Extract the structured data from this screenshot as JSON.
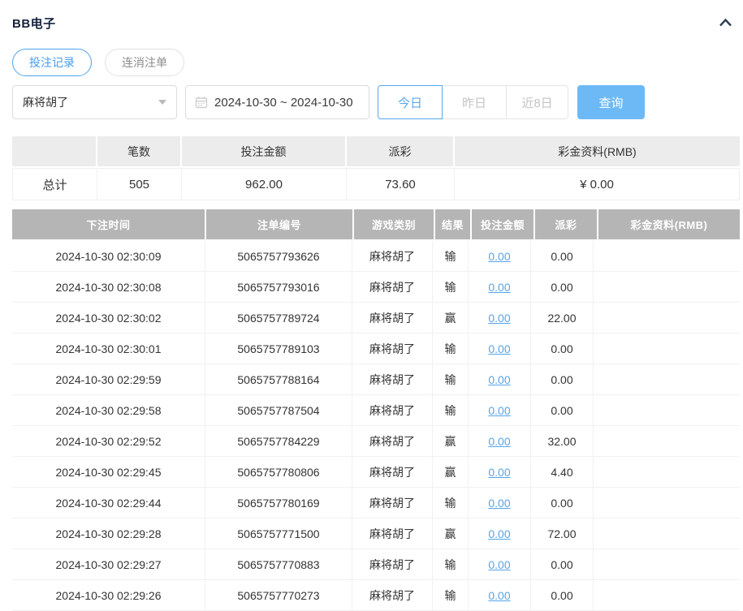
{
  "page": {
    "title": "BB电子"
  },
  "tabs": [
    {
      "label": "投注记录",
      "active": true
    },
    {
      "label": "连消注单",
      "active": false
    }
  ],
  "filters": {
    "game_select": {
      "value": "麻将胡了"
    },
    "date_range": {
      "value": "2024-10-30 ~ 2024-10-30"
    },
    "quick_ranges": [
      {
        "label": "今日",
        "active": true
      },
      {
        "label": "昨日",
        "active": false
      },
      {
        "label": "近8日",
        "active": false
      }
    ],
    "search_label": "查询"
  },
  "summary_table": {
    "headers": [
      "",
      "笔数",
      "投注金额",
      "派彩",
      "彩金资料(RMB)"
    ],
    "totals_row": [
      "总计",
      "505",
      "962.00",
      "73.60",
      "¥ 0.00"
    ]
  },
  "detail_table": {
    "headers": [
      "下注时间",
      "注单编号",
      "游戏类别",
      "结果",
      "投注金额",
      "派彩",
      "彩金资料(RMB)"
    ],
    "rows": [
      [
        "2024-10-30 02:30:09",
        "5065757793626",
        "麻将胡了",
        "输",
        "0.00",
        "0.00",
        ""
      ],
      [
        "2024-10-30 02:30:08",
        "5065757793016",
        "麻将胡了",
        "输",
        "0.00",
        "0.00",
        ""
      ],
      [
        "2024-10-30 02:30:02",
        "5065757789724",
        "麻将胡了",
        "赢",
        "0.00",
        "22.00",
        ""
      ],
      [
        "2024-10-30 02:30:01",
        "5065757789103",
        "麻将胡了",
        "输",
        "0.00",
        "0.00",
        ""
      ],
      [
        "2024-10-30 02:29:59",
        "5065757788164",
        "麻将胡了",
        "输",
        "0.00",
        "0.00",
        ""
      ],
      [
        "2024-10-30 02:29:58",
        "5065757787504",
        "麻将胡了",
        "输",
        "0.00",
        "0.00",
        ""
      ],
      [
        "2024-10-30 02:29:52",
        "5065757784229",
        "麻将胡了",
        "赢",
        "0.00",
        "32.00",
        ""
      ],
      [
        "2024-10-30 02:29:45",
        "5065757780806",
        "麻将胡了",
        "赢",
        "0.00",
        "4.40",
        ""
      ],
      [
        "2024-10-30 02:29:44",
        "5065757780169",
        "麻将胡了",
        "输",
        "0.00",
        "0.00",
        ""
      ],
      [
        "2024-10-30 02:29:28",
        "5065757771500",
        "麻将胡了",
        "赢",
        "0.00",
        "72.00",
        ""
      ],
      [
        "2024-10-30 02:29:27",
        "5065757770883",
        "麻将胡了",
        "输",
        "0.00",
        "0.00",
        ""
      ],
      [
        "2024-10-30 02:29:26",
        "5065757770273",
        "麻将胡了",
        "输",
        "0.00",
        "0.00",
        ""
      ]
    ]
  },
  "colors": {
    "accent_blue": "#4da3ee",
    "link_blue": "#56a4e8",
    "search_button_bg": "#6db9f6",
    "detail_header_bg": "#b5b5b5",
    "summary_header_bg": "#ececec",
    "border_light": "#f0f0f0",
    "text_dark": "#333333",
    "disabled_text": "#c4c4c4",
    "title_color": "#16233d"
  }
}
